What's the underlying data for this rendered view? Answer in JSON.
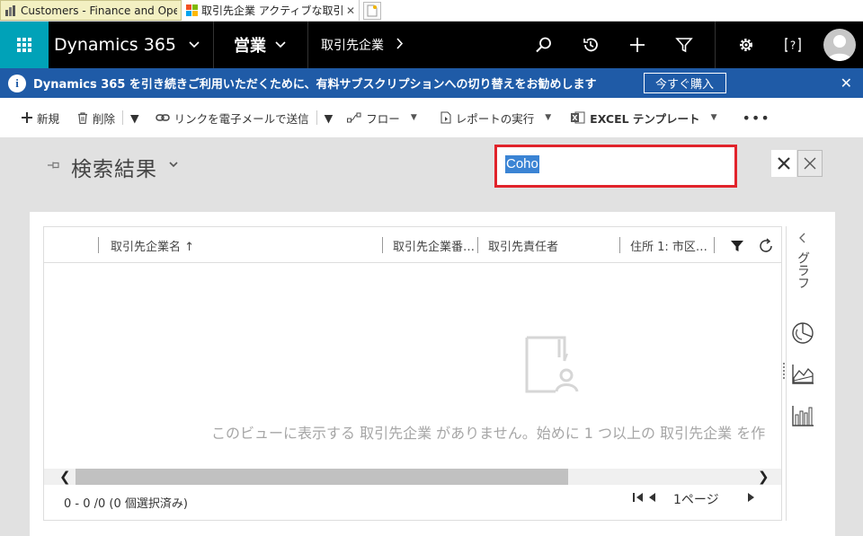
{
  "browser": {
    "tabs": [
      {
        "title": "Customers - Finance and Oper...",
        "active": false
      },
      {
        "title": "取引先企業 アクティブな取引...",
        "active": true
      }
    ]
  },
  "nav": {
    "brand": "Dynamics 365",
    "area": "営業",
    "entity": "取引先企業",
    "icons": [
      "search-icon",
      "history-icon",
      "plus-icon",
      "filter-icon",
      "gear-icon",
      "help-icon",
      "user-avatar"
    ]
  },
  "infobar": {
    "message": "Dynamics 365 を引き続きご利用いただくために、有料サブスクリプションへの切り替えをお勧めします",
    "buy_label": "今すぐ購入"
  },
  "commands": {
    "new": "新規",
    "delete": "削除",
    "email_link": "リンクを電子メールで送信",
    "flow": "フロー",
    "run_report": "レポートの実行",
    "excel_templates": "EXCEL テンプレート",
    "more": "•••"
  },
  "header": {
    "title": "検索結果",
    "search_value": "Coho"
  },
  "grid": {
    "columns": [
      "取引先企業名 ↑",
      "取引先企業番…",
      "取引先責任者",
      "住所 1: 市区…"
    ],
    "empty_message": "このビューに表示する 取引先企業 がありません。始めに 1 つ以上の 取引先企業 を作",
    "status": "0 - 0 /0 (0 個選択済み)",
    "page_label": "1ページ"
  },
  "sidepane": {
    "label": "グラフ"
  },
  "colors": {
    "nav_bg": "#000000",
    "waffle_bg": "#00a2b8",
    "info_bg": "#1f5ba7",
    "highlight_border": "#e1232b",
    "gray_bg": "#e1e1e1"
  }
}
